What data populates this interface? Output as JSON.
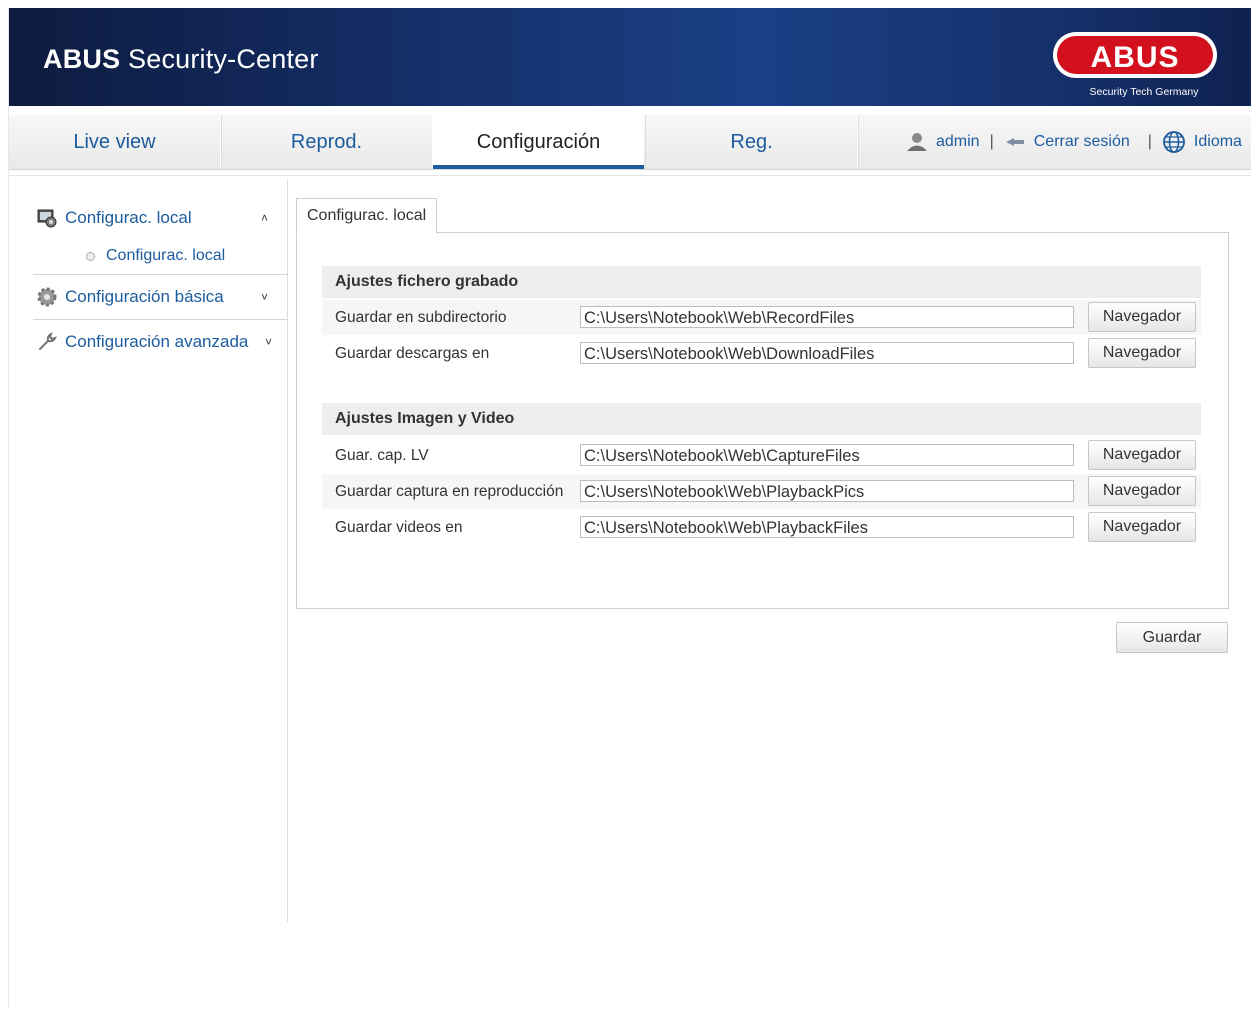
{
  "header": {
    "brand": "ABUS",
    "product": "Security-Center",
    "logo_text": "ABUS",
    "logo_tagline": "Security Tech Germany"
  },
  "nav": {
    "tabs": [
      {
        "label": "Live view",
        "active": false
      },
      {
        "label": "Reprod.",
        "active": false
      },
      {
        "label": "Configuración",
        "active": true
      },
      {
        "label": "Reg.",
        "active": false
      }
    ],
    "user": "admin",
    "logout": "Cerrar sesión",
    "language": "Idioma",
    "separator": "|"
  },
  "sidebar": {
    "items": [
      {
        "label": "Configurac. local",
        "icon": "local-config-icon",
        "expanded": true,
        "children": [
          {
            "label": "Configurac. local"
          }
        ]
      },
      {
        "label": "Configuración básica",
        "icon": "gear-icon",
        "expanded": false
      },
      {
        "label": "Configuración avanzada",
        "icon": "wrench-icon",
        "expanded": false
      }
    ]
  },
  "content": {
    "tab": "Configurac. local",
    "sections": [
      {
        "title": "Ajustes fichero grabado",
        "rows": [
          {
            "label": "Guardar en subdirectorio",
            "value": "C:\\Users\\Notebook\\Web\\RecordFiles",
            "button": "Navegador"
          },
          {
            "label": "Guardar descargas en",
            "value": "C:\\Users\\Notebook\\Web\\DownloadFiles",
            "button": "Navegador"
          }
        ]
      },
      {
        "title": "Ajustes Imagen y Video",
        "rows": [
          {
            "label": "Guar. cap. LV",
            "value": "C:\\Users\\Notebook\\Web\\CaptureFiles",
            "button": "Navegador"
          },
          {
            "label": "Guardar captura en reproducción",
            "value": "C:\\Users\\Notebook\\Web\\PlaybackPics",
            "button": "Navegador"
          },
          {
            "label": "Guardar videos en",
            "value": "C:\\Users\\Notebook\\Web\\PlaybackFiles",
            "button": "Navegador"
          }
        ]
      }
    ],
    "save_button": "Guardar"
  },
  "colors": {
    "header_dark": "#0d1b3f",
    "header_mid": "#1b3f86",
    "link_blue": "#1c5b9e",
    "logo_red": "#d3101d"
  }
}
